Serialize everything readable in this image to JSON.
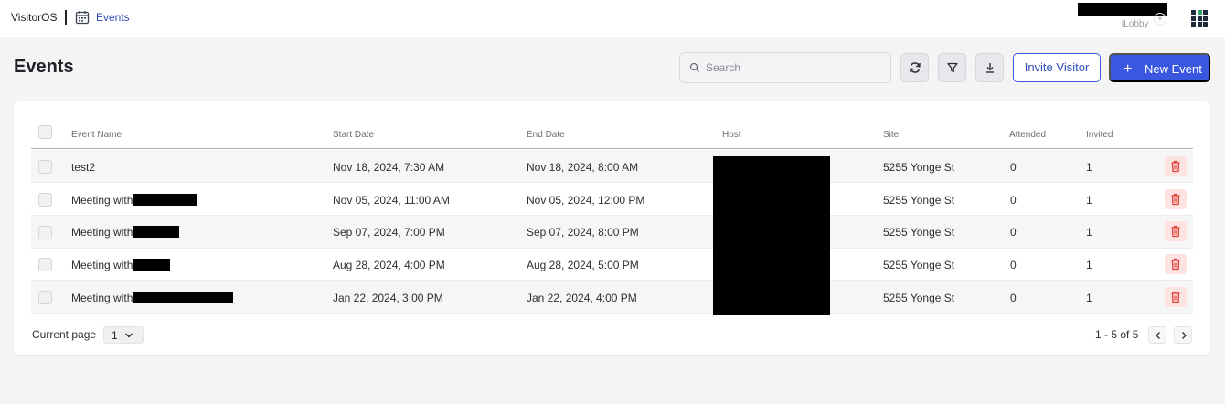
{
  "app": {
    "brand": "VisitorOS",
    "breadcrumb": "Events",
    "user_sub": "iLobby",
    "brand_color": "#3a57e0"
  },
  "page": {
    "title": "Events",
    "search_placeholder": "Search",
    "invite_label": "Invite Visitor",
    "new_event_label": "New Event"
  },
  "table": {
    "headers": {
      "event_name": "Event Name",
      "start_date": "Start Date",
      "end_date": "End Date",
      "host": "Host",
      "site": "Site",
      "attended": "Attended",
      "invited": "Invited"
    },
    "rows": [
      {
        "name": "test2",
        "start": "Nov 18, 2024, 7:30 AM",
        "end": "Nov 18, 2024, 8:00 AM",
        "site": "5255 Yonge St",
        "attended": "0",
        "invited": "1"
      },
      {
        "name": "Meeting with",
        "start": "Nov 05, 2024, 11:00 AM",
        "end": "Nov 05, 2024, 12:00 PM",
        "site": "5255 Yonge St",
        "attended": "0",
        "invited": "1"
      },
      {
        "name": "Meeting with",
        "start": "Sep 07, 2024, 7:00 PM",
        "end": "Sep 07, 2024, 8:00 PM",
        "site": "5255 Yonge St",
        "attended": "0",
        "invited": "1"
      },
      {
        "name": "Meeting with",
        "start": "Aug 28, 2024, 4:00 PM",
        "end": "Aug 28, 2024, 5:00 PM",
        "site": "5255 Yonge St",
        "attended": "0",
        "invited": "1"
      },
      {
        "name": "Meeting with",
        "start": "Jan 22, 2024, 3:00 PM",
        "end": "Jan 22, 2024, 4:00 PM",
        "site": "5255 Yonge St",
        "attended": "0",
        "invited": "1"
      }
    ]
  },
  "footer": {
    "current_page_label": "Current page",
    "current_page": "1",
    "range": "1 - 5 of 5"
  }
}
